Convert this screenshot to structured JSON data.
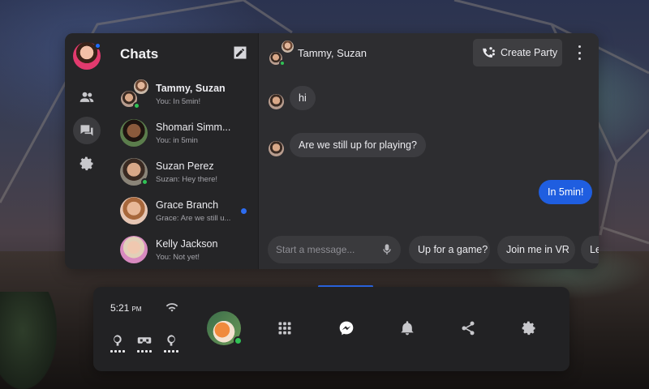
{
  "sidebar": {
    "items": [
      {
        "icon": "people-icon"
      },
      {
        "icon": "chat-bubbles-icon",
        "active": true
      },
      {
        "icon": "gear-icon"
      }
    ]
  },
  "chats": {
    "title": "Chats",
    "items": [
      {
        "name": "Tammy, Suzan",
        "preview": "You: In 5min!",
        "bold": true,
        "online": true,
        "group": true
      },
      {
        "name": "Shomari Simm...",
        "preview": "You: in 5min",
        "online": false
      },
      {
        "name": "Suzan Perez",
        "preview": "Suzan: Hey there!",
        "online": true
      },
      {
        "name": "Grace Branch",
        "preview": "Grace: Are we still u...",
        "unread": true
      },
      {
        "name": "Kelly Jackson",
        "preview": "You: Not yet!"
      }
    ]
  },
  "conversation": {
    "title": "Tammy, Suzan",
    "create_party_label": "Create Party",
    "messages": [
      {
        "text": "hi",
        "mine": false
      },
      {
        "text": "Are we still up for playing?",
        "mine": false
      },
      {
        "text": "In 5min!",
        "mine": true
      }
    ],
    "input_placeholder": "Start a message...",
    "quick_replies": [
      "Up for a game?",
      "Join me in VR",
      "Le"
    ]
  },
  "dock": {
    "time": "5:21",
    "ampm": "PM",
    "devices": [
      "left-controller-icon",
      "headset-icon",
      "right-controller-icon"
    ],
    "apps": [
      "app-grid-icon",
      "messenger-icon",
      "bell-icon",
      "share-icon",
      "gear-icon"
    ],
    "active_app": "messenger-icon"
  },
  "colors": {
    "accent": "#1f5ee0",
    "online": "#30c255",
    "panel": "#2b2b2d"
  }
}
